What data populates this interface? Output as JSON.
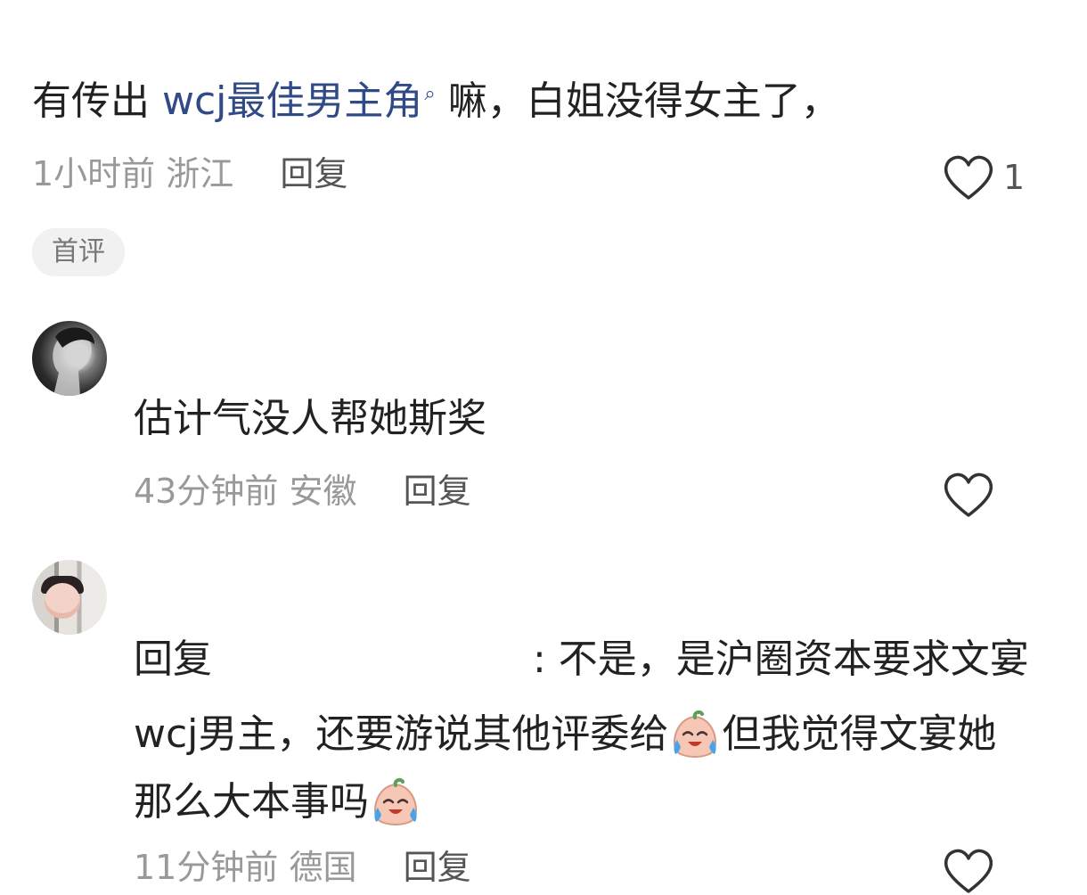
{
  "comments": [
    {
      "text_before": "有传出 ",
      "link_text": "wcj最佳男主角",
      "search_icon": "search-icon",
      "text_after": "嘛，白姐没得女主了，",
      "time": "1小时前",
      "location": "浙江",
      "reply_label": "回复",
      "like_count": "1",
      "badge": "首评"
    },
    {
      "avatar": "avatar-grayscale-portrait",
      "text": "估计气没人帮她斯奖",
      "time": "43分钟前",
      "location": "安徽",
      "reply_label": "回复"
    },
    {
      "avatar": "avatar-child-photo",
      "reply_prefix": "回复",
      "line1_tail": ": 不是，是沪圈资本要求文宴",
      "line2_a": "wcj男主，还要游说其他评委给",
      "line2_b": "但我觉得文宴她",
      "line3": "那么大本事吗",
      "emoji": "crying-laughing-peach-emoji",
      "time": "11分钟前",
      "location": "德国",
      "reply_label": "回复"
    }
  ],
  "colors": {
    "link": "#2f4a86",
    "meta_gray": "#999999",
    "reply_gray": "#555555",
    "text": "#222222"
  }
}
